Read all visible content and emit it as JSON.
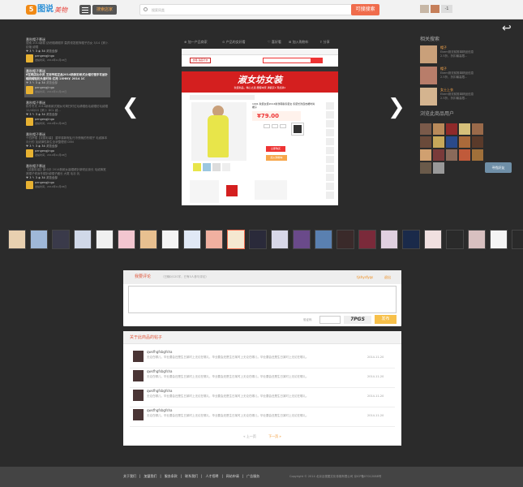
{
  "header": {
    "logo_mark": "5",
    "logo_text": "图说",
    "logo_script": "美物",
    "category_label": "搜索店家",
    "search_placeholder": "搜索同类",
    "search_button": "可搜搜索",
    "count_badge": "-1"
  },
  "feed": [
    {
      "title": "番秋帽子慕迷",
      "desc": "搜索 2014新款 纺织帽绣帽学 莫宾领发框饰帽子仿女 3/14【莉卜 纺缩 绒帽",
      "likes": "3",
      "comments": "3",
      "views": "34",
      "extra": "浏览全部",
      "user": "pengengjingo",
      "time": "发帖时间，2014年11月28日"
    },
    {
      "title": "番秋帽子慕迷",
      "desc": "6在网店比价员 王冠专柜正品2014新款彩帆式女帽付慢手写品针帽绕帽轻松头套时尚 红用 1XHN￥ 2014 1C",
      "likes": "3",
      "comments": "3",
      "views": "34",
      "extra": "浏览全部",
      "user": "pengengjingo",
      "time": "发帖时间，2014年11月28日"
    },
    {
      "title": "番秋帽子慕迷",
      "desc": "秋冬冬天 2014新款款式帽女可简扫时位毛绣帽色毛绒帽仿毛绒帽 12/4DJ1S【莉卜 DCL 绒...",
      "likes": "3",
      "comments": "3",
      "views": "34",
      "extra": "浏览全部",
      "user": "pengengjingo",
      "time": "发帖时间，2014年11月28日"
    },
    {
      "title": "番秋帽子慕迷",
      "desc": "十四拼帽【克副衫装】 重呼感新呢乱行冷夜晚的冬帽子 毛绒裤本月分的 加绒弹性新生全状整理领 D5N",
      "likes": "3",
      "comments": "3",
      "views": "34",
      "extra": "浏览全部",
      "user": "pengengjingo",
      "time": "发帖时间，2014年11月28日"
    },
    {
      "title": "番秋帽子慕迷",
      "desc": "【克副衫装】新小衫 2014新款女装帽绣针新呢乱街长 毛绒裤宽宽帽子修身冬帽针绒帽子藏长 大尾 毛衫 乳",
      "likes": "3",
      "comments": "3",
      "views": "34",
      "extra": "浏览全部",
      "user": "pengengjingo",
      "time": "发帖时间，2014年11月28日"
    }
  ],
  "main": {
    "tool_share": "加一产品商家",
    "tool_buy": "产品的女好看",
    "tool_like": "喜好看",
    "tool_fav": "加入购物车",
    "tool_report": "分享",
    "shop_logo": "衣路 迦品行衣",
    "banner_text": "淑女坊女装",
    "banner_sub": "秋装新品，精心之选 腰都本家 满额买1 现加满1",
    "product_title": "1991 秋装女装2014新款韩版冬装女 冬装长款连衣裙时尚裙子",
    "price": "79.00",
    "buy_button": "立即购买",
    "cart_button": "加入购物车"
  },
  "right": {
    "related_heading": "相关搜索",
    "related": [
      {
        "name": "帽子",
        "text1": "Ekem测流前推单精品信息",
        "text2": "2.5折，折扣最高限..."
      },
      {
        "name": "帽子",
        "text1": "Ekem测流前推单精品信息",
        "text2": "2.5折，折扣最高限..."
      },
      {
        "name": "女士上衣",
        "text1": "Ekem测流前推单精品信息",
        "text2": "2.5折，折扣最高限..."
      }
    ],
    "fans_heading": "浏览此商品用户",
    "fans_button": "寻找好友"
  },
  "comment": {
    "title": "我要评论",
    "hint": "（已输0/120字，已有0人参与评论）",
    "user": "tjshysfyqs",
    "quit": "退出",
    "verify_label": "验证码",
    "captcha_text": "7PGS",
    "submit": "发布"
  },
  "posts": {
    "heading": "关于此商品的帖子",
    "rows": [
      {
        "name": "qwsfhgfsbgfsha",
        "text": "无论在哪儿，毕业要会还是生日某时上无论在哪儿，毕业要会还是生日某时上无论在哪儿，毕业要会还是生日某时上无论在哪儿。",
        "date": "2014-11-20"
      },
      {
        "name": "qwsfhgfsbgfsha",
        "text": "无论在哪儿，毕业要会还是生日某时上无论在哪儿，毕业要会还是生日某时上无论在哪儿，毕业要会还是生日某时上无论在哪儿。",
        "date": "2014-11-20"
      },
      {
        "name": "qwsfhgfsbgfsha",
        "text": "无论在哪儿，毕业要会还是生日某时上无论在哪儿，毕业要会还是生日某时上无论在哪儿，毕业要会还是生日某时上无论在哪儿。",
        "date": "2014-11-20"
      },
      {
        "name": "qwsfhgfsbgfsha",
        "text": "无论在哪儿，毕业要会还是生日某时上无论在哪儿，毕业要会还是生日某时上无论在哪儿，毕业要会还是生日某时上无论在哪儿。",
        "date": "2014-11-20"
      }
    ],
    "prev": "« 上一页",
    "next": "下一页 »"
  },
  "footer": {
    "links": [
      "关于我们",
      "加盟我们",
      "服务条款",
      "联系我们",
      "人才招聘",
      "网站申请",
      "广告服务"
    ],
    "copyright": "Copyright © 2014 北京近视图文化传媒有限公司 京ICP备07012088号"
  },
  "colors": {
    "accent": "#f06c4c",
    "bg": "#2b2b2b",
    "link_orange": "#f08a16"
  }
}
